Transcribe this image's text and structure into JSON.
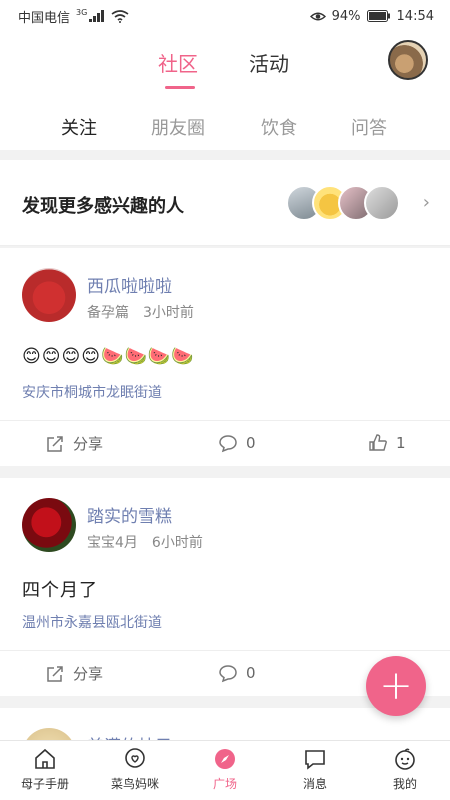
{
  "status": {
    "carrier": "中国电信",
    "network": "3G",
    "battery": "94%",
    "time": "14:54"
  },
  "header": {
    "tabs": [
      {
        "label": "社区"
      },
      {
        "label": "活动"
      }
    ]
  },
  "subtabs": [
    {
      "label": "关注"
    },
    {
      "label": "朋友圈"
    },
    {
      "label": "饮食"
    },
    {
      "label": "问答"
    }
  ],
  "discover": {
    "title": "发现更多感兴趣的人"
  },
  "posts": [
    {
      "name": "西瓜啦啦啦",
      "stage": "备孕篇",
      "time": "3小时前",
      "text": "😊😊😊😊🍉🍉🍉🍉",
      "location": "安庆市桐城市龙眠街道",
      "share": "分享",
      "comments": "0",
      "likes": "1"
    },
    {
      "name": "踏实的雪糕",
      "stage": "宝宝4月",
      "time": "6小时前",
      "text": "四个月了",
      "location": "温州市永嘉县瓯北街道",
      "share": "分享",
      "comments": "0"
    },
    {
      "name": "美满的柚子"
    }
  ],
  "fab": {
    "label": "+"
  },
  "bottom_nav": [
    {
      "label": "母子手册"
    },
    {
      "label": "菜鸟妈咪"
    },
    {
      "label": "广场"
    },
    {
      "label": "消息"
    },
    {
      "label": "我的"
    }
  ],
  "colors": {
    "accent": "#f0648a",
    "name": "#6f7fb0"
  }
}
